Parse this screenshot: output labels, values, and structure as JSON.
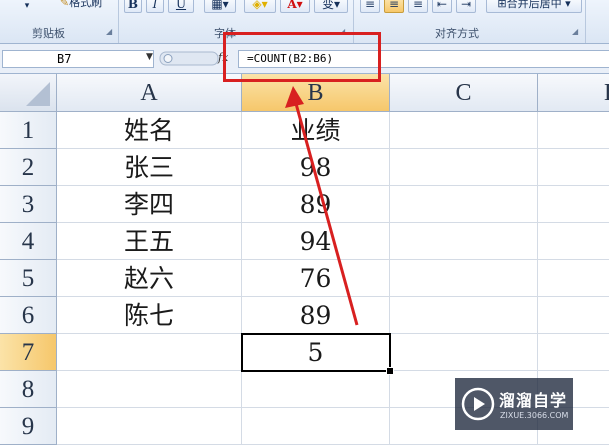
{
  "ribbon": {
    "buttons": {
      "format_painter": "格式刷",
      "bold": "B",
      "italic": "I",
      "underline": "U",
      "wrap": "变"
    },
    "groups": {
      "clipboard": "剪贴板",
      "font": "字体",
      "alignment": "对齐方式"
    },
    "merge_center": "合并后居中"
  },
  "formula_bar": {
    "name_box": "B7",
    "fx": "fx",
    "formula": "=COUNT(B2:B6)"
  },
  "grid": {
    "columns": [
      "A",
      "B",
      "C",
      "D"
    ],
    "active_column": "B",
    "rows": [
      "1",
      "2",
      "3",
      "4",
      "5",
      "6",
      "7",
      "8",
      "9"
    ],
    "active_row": "7",
    "cells": {
      "A1": "姓名",
      "B1": "业绩",
      "A2": "张三",
      "B2": "98",
      "A3": "李四",
      "B3": "89",
      "A4": "王五",
      "B4": "94",
      "A5": "赵六",
      "B5": "76",
      "A6": "陈七",
      "B6": "89",
      "A7": "",
      "B7": "5"
    }
  },
  "colors": {
    "annotation": "#d82020",
    "active_header": "#f6c76b"
  },
  "watermark": {
    "title": "溜溜自学",
    "subtitle": "ZIXUE.3066.COM"
  }
}
